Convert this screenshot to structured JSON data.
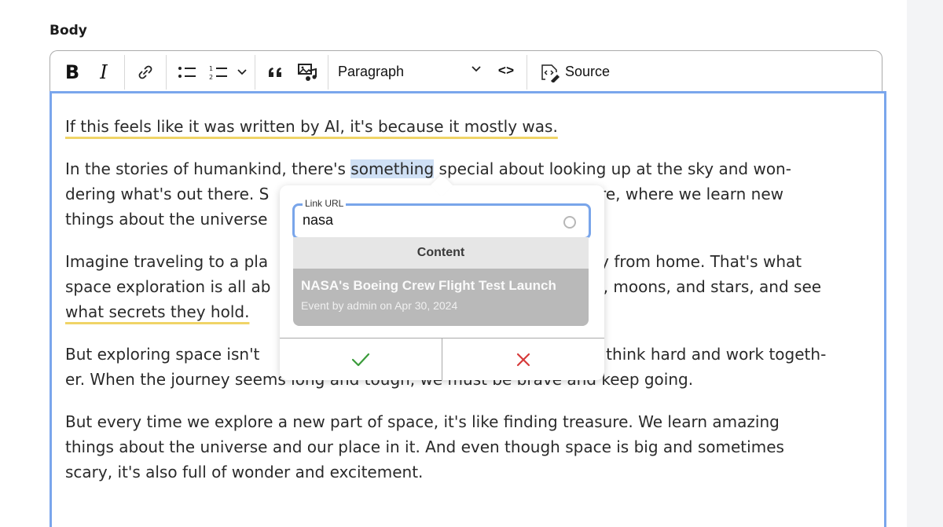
{
  "field": {
    "label": "Body"
  },
  "toolbar": {
    "bold": "B",
    "italic": "I",
    "heading_value": "Paragraph",
    "code": "<>",
    "source": "Source"
  },
  "editor": {
    "p1": "If this feels like it was written by AI, it's because it mostly was.",
    "p2": {
      "l1_a": "In the stories of humankind, there's ",
      "l1_sel": "something",
      "l1_b": " special about looking up at the sky and won-",
      "l2_a": "dering what's out there. S",
      "l2_b": "ure, where we learn new",
      "l3": "things about the universe"
    },
    "p3": {
      "l1_a": "Imagine traveling to a pla",
      "l1_b": "vay from home. That's what",
      "l2_a": "space exploration is all ab",
      "l2_b": "nets, moons, and stars, and see",
      "l3": "what secrets they hold."
    },
    "p4": {
      "l1_a": "But exploring space isn't",
      "l1_b": "s think hard and work togeth-",
      "l2": "er. When the journey seems long and tough, we must be brave and keep going."
    },
    "p5": {
      "l1": "But every time we explore a new part of space, it's like finding treasure. We learn amazing",
      "l2": "things about the universe and our place in it. And even though space is big and sometimes",
      "l3": "scary, it's also full of wonder and excitement."
    }
  },
  "link_popup": {
    "field_label": "Link URL",
    "value": "nasa",
    "section_header": "Content",
    "suggestion": {
      "title": "NASA's Boeing Crew Flight Test Launch",
      "meta": "Event by admin on Apr 30, 2024"
    },
    "save_color": "#3a9b3a",
    "cancel_color": "#d63a3a"
  },
  "colors": {
    "accent": "#7aa6ec",
    "underline": "#f0d467",
    "selection": "#cfe0f5"
  }
}
